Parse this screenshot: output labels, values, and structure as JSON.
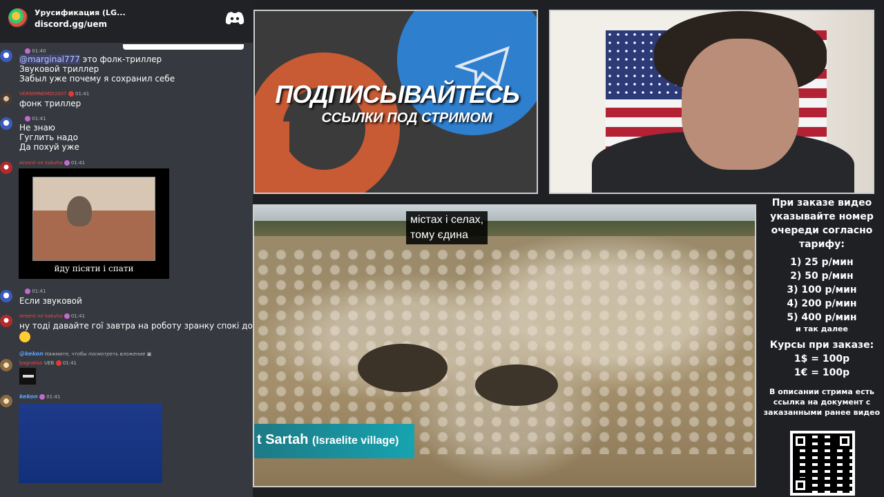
{
  "discord": {
    "server_name": "Урусификация (LG...",
    "invite": "discord.gg/uem"
  },
  "chat": {
    "m1": {
      "time": "01:40",
      "mention": "@marginal777",
      "l1_rest": " это фолк-триллер",
      "l2": "Звуковой триллер",
      "l3": "Забыл уже почему я сохранил себе"
    },
    "m2": {
      "nick": "VERNIMNEMOI2007",
      "time": "01:41",
      "l1": "фонк триллер"
    },
    "m3": {
      "time": "01:41",
      "l1": "Не знаю",
      "l2": "Гуглить надо",
      "l3": "Да похуй уже"
    },
    "m4": {
      "nick": "Arsenii ne kakuha",
      "time": "01:41",
      "caption": "йду пісяти і спати"
    },
    "m5": {
      "time": "01:41",
      "l1": "Если звуковой"
    },
    "m6": {
      "nick": "Arsenii ne kakuha",
      "time": "01:41",
      "l1": "ну тоді давайте гої завтра на роботу зранку  спокі докі"
    },
    "m7": {
      "reply_nick": "@kekon",
      "reply_text": "Нажмите, чтобы посмотреть вложение",
      "nick": "bagratian",
      "tag": "UEB",
      "time": "01:41"
    },
    "m8": {
      "nick": "kekon",
      "time": "01:41"
    }
  },
  "banner": {
    "title": "ПОДПИСЫВАЙТЕСЬ",
    "subtitle": "ССЫЛКИ ПОД СТРИМОМ"
  },
  "video": {
    "subtitle_l1": "містах і селах,",
    "subtitle_l2": "тому єдина",
    "place_name": "t Sartah",
    "place_desc": "(Israelite village)"
  },
  "info": {
    "head": "При заказе видео указывайте номер очереди согласно тарифу:",
    "tiers": [
      "1) 25 р/мин",
      "2) 50 р/мин",
      "3) 100 р/мин",
      "4) 200 р/мин",
      "5) 400 р/мин"
    ],
    "etc": "и так далее",
    "rates_head": "Курсы при заказе:",
    "rates": [
      "1$ = 100р",
      "1€ = 100р"
    ],
    "desc": "В описании стрима есть ссылка на документ с заказанными ранее видео"
  },
  "colors": {
    "chat_bg": "#36393f",
    "server_bar": "#202225",
    "patreon": "#c85a34",
    "telegram": "#2f7fcf",
    "place_tag": "#17a3b0"
  }
}
